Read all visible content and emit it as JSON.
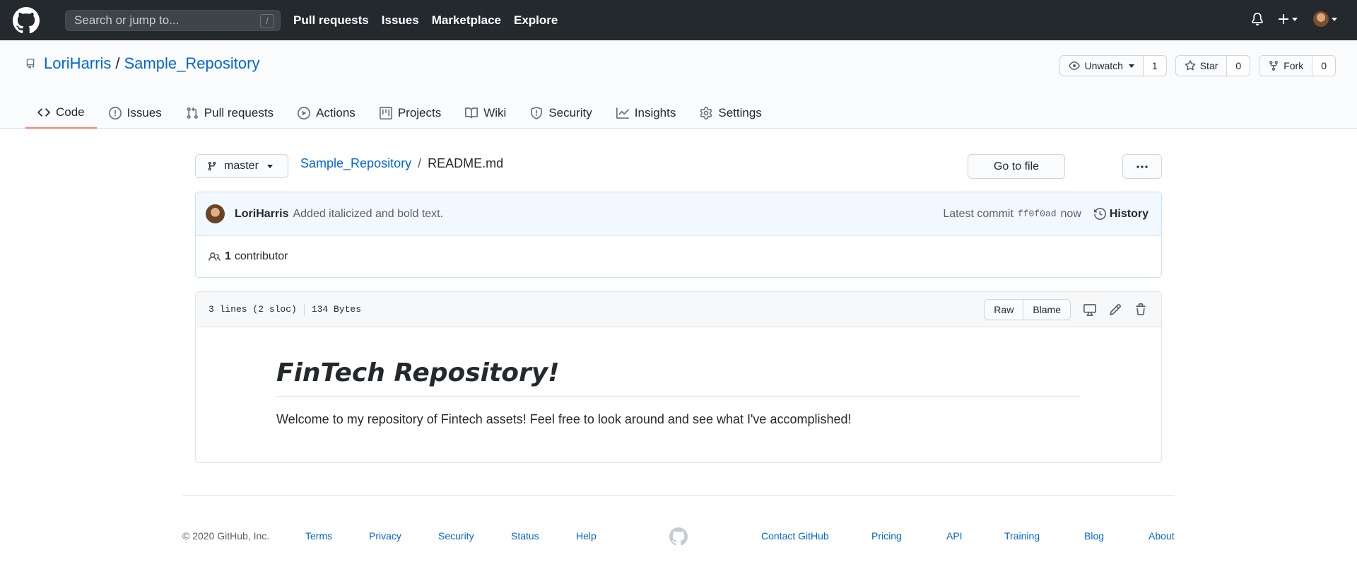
{
  "header": {
    "search_placeholder": "Search or jump to...",
    "search_shortcut": "/",
    "nav": [
      "Pull requests",
      "Issues",
      "Marketplace",
      "Explore"
    ],
    "icons": [
      "github-logo",
      "bell-icon",
      "plus-icon",
      "avatar"
    ]
  },
  "repo": {
    "owner": "LoriHarris",
    "separator": "/",
    "name": "Sample_Repository",
    "watch_label": "Unwatch",
    "watch_count": "1",
    "star_label": "Star",
    "star_count": "0",
    "fork_label": "Fork",
    "fork_count": "0"
  },
  "tabs": [
    {
      "label": "Code",
      "icon": "code-icon",
      "active": true
    },
    {
      "label": "Issues",
      "icon": "issue-icon"
    },
    {
      "label": "Pull requests",
      "icon": "pull-request-icon"
    },
    {
      "label": "Actions",
      "icon": "play-icon"
    },
    {
      "label": "Projects",
      "icon": "project-icon"
    },
    {
      "label": "Wiki",
      "icon": "book-icon"
    },
    {
      "label": "Security",
      "icon": "shield-icon"
    },
    {
      "label": "Insights",
      "icon": "graph-icon"
    },
    {
      "label": "Settings",
      "icon": "gear-icon"
    }
  ],
  "file": {
    "branch": "master",
    "breadcrumb_repo": "Sample_Repository",
    "breadcrumb_sep": "/",
    "filename": "README.md",
    "go_to_file": "Go to file",
    "more": "···"
  },
  "commit": {
    "author": "LoriHarris",
    "message": "Added italicized and bold text.",
    "latest_label": "Latest commit",
    "sha": "ff0f0ad",
    "time": "now",
    "history": "History",
    "contributors_count": "1",
    "contributors_label": "contributor"
  },
  "fileinfo": {
    "lines": "3 lines (2 sloc)",
    "size": "134 Bytes",
    "raw": "Raw",
    "blame": "Blame"
  },
  "readme": {
    "heading": "FinTech Repository!",
    "body": "Welcome to my repository of Fintech assets! Feel free to look around and see what I've accomplished!"
  },
  "footer": {
    "copyright": "© 2020 GitHub, Inc.",
    "left_links": [
      "Terms",
      "Privacy",
      "Security",
      "Status",
      "Help"
    ],
    "right_links": [
      "Contact GitHub",
      "Pricing",
      "API",
      "Training",
      "Blog",
      "About"
    ]
  },
  "colors": {
    "header_bg": "#24292e",
    "link": "#0366d6",
    "active_tab_underline": "#f9826c",
    "commit_bg": "#f1f8ff"
  }
}
